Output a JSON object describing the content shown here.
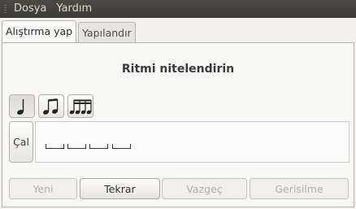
{
  "menubar": {
    "items": [
      "Dosya",
      "Yardım"
    ]
  },
  "tabs": [
    {
      "label": "Alıştırma yap",
      "active": true
    },
    {
      "label": "Yapılandır",
      "active": false
    }
  ],
  "exercise": {
    "title": "Ritmi nitelendirin",
    "rhythm_buttons": [
      {
        "icon": "quarter-note-icon",
        "selected": true
      },
      {
        "icon": "eighth-notes-icon",
        "selected": false
      },
      {
        "icon": "sixteenth-notes-icon",
        "selected": false
      }
    ],
    "play_label": "Çal",
    "slot_count": 4
  },
  "actions": [
    {
      "label": "Yeni",
      "enabled": false
    },
    {
      "label": "Tekrar",
      "enabled": true
    },
    {
      "label": "Vazgeç",
      "enabled": false
    },
    {
      "label": "Gerisilme",
      "enabled": false
    }
  ]
}
